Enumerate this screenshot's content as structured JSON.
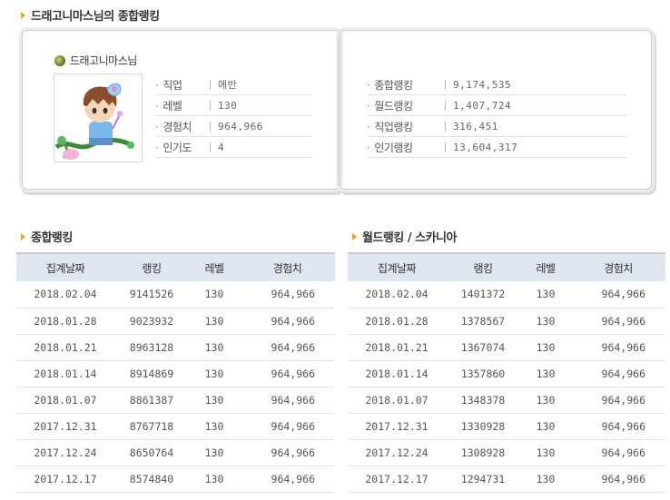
{
  "page_title": "드래고니마스님의 종합랭킹",
  "profile": {
    "name": "드래고니마스님",
    "info": [
      {
        "label": "직업",
        "value": "에반"
      },
      {
        "label": "레벨",
        "value": "130"
      },
      {
        "label": "경험치",
        "value": "964,966"
      },
      {
        "label": "인기도",
        "value": "4"
      }
    ],
    "ranks": [
      {
        "label": "종합랭킹",
        "value": "9,174,535"
      },
      {
        "label": "월드랭킹",
        "value": "1,407,724"
      },
      {
        "label": "직업랭킹",
        "value": "316,451"
      },
      {
        "label": "인기랭킹",
        "value": "13,604,317"
      }
    ]
  },
  "overall_ranking": {
    "title": "종합랭킹",
    "headers": [
      "집계날짜",
      "랭킹",
      "레벨",
      "경험치"
    ],
    "rows": [
      [
        "2018.02.04",
        "9141526",
        "130",
        "964,966"
      ],
      [
        "2018.01.28",
        "9023932",
        "130",
        "964,966"
      ],
      [
        "2018.01.21",
        "8963128",
        "130",
        "964,966"
      ],
      [
        "2018.01.14",
        "8914869",
        "130",
        "964,966"
      ],
      [
        "2018.01.07",
        "8861387",
        "130",
        "964,966"
      ],
      [
        "2017.12.31",
        "8767718",
        "130",
        "964,966"
      ],
      [
        "2017.12.24",
        "8650764",
        "130",
        "964,966"
      ],
      [
        "2017.12.17",
        "8574840",
        "130",
        "964,966"
      ]
    ]
  },
  "world_ranking": {
    "title": "월드랭킹 / 스카니아",
    "headers": [
      "집계날짜",
      "랭킹",
      "레벨",
      "경험치"
    ],
    "rows": [
      [
        "2018.02.04",
        "1401372",
        "130",
        "964,966"
      ],
      [
        "2018.01.28",
        "1378567",
        "130",
        "964,966"
      ],
      [
        "2018.01.21",
        "1367074",
        "130",
        "964,966"
      ],
      [
        "2018.01.14",
        "1357860",
        "130",
        "964,966"
      ],
      [
        "2018.01.07",
        "1348378",
        "130",
        "964,966"
      ],
      [
        "2017.12.31",
        "1330928",
        "130",
        "964,966"
      ],
      [
        "2017.12.24",
        "1308928",
        "130",
        "964,966"
      ],
      [
        "2017.12.17",
        "1294731",
        "130",
        "964,966"
      ]
    ]
  },
  "colors": {
    "accent_arrow": "#f0a020",
    "table_header_bg": "#dfe6ef"
  }
}
